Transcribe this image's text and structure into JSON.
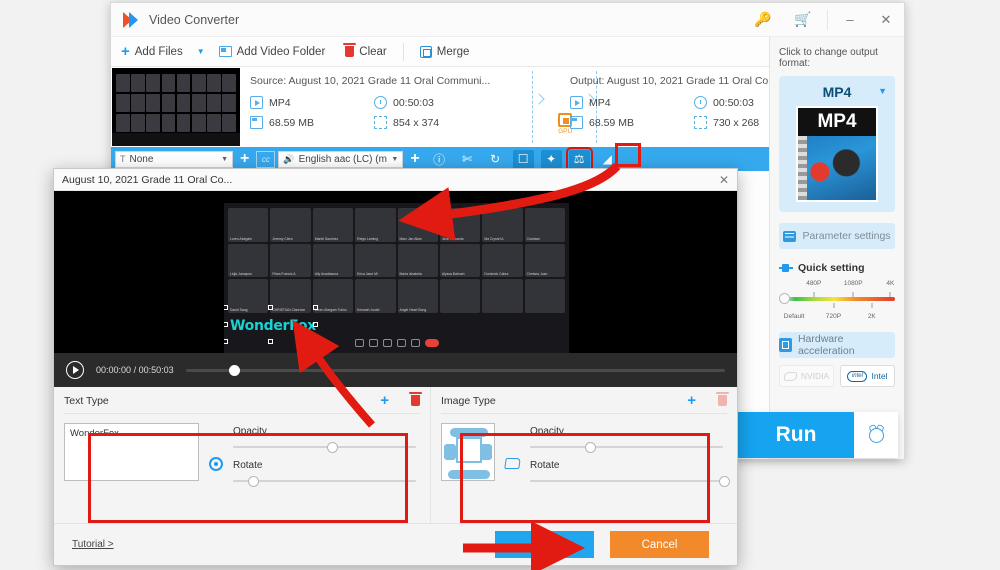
{
  "window": {
    "title": "Video Converter",
    "icons": {
      "key": "key-icon",
      "cart": "cart-icon",
      "minimize": "–",
      "close": "✕"
    }
  },
  "toolbar": {
    "add_files": "Add Files",
    "add_video_folder": "Add Video Folder",
    "clear": "Clear",
    "merge": "Merge"
  },
  "file_row": {
    "source_label": "Source: August 10, 2021 Grade 11 Oral Communi...",
    "output_label": "Output: August 10, 2021 Grade 11 Oral Com...",
    "source": {
      "format": "MP4",
      "duration": "00:50:03",
      "size": "68.59 MB",
      "resolution": "854 x 374"
    },
    "output": {
      "format": "MP4",
      "duration": "00:50:03",
      "size": "68.59 MB",
      "resolution": "730 x 268"
    },
    "gpu_badge": "GPU"
  },
  "blue_bar": {
    "subtitle_select": "None",
    "audio_select": "English aac (LC) (m",
    "tools": [
      "info-icon",
      "cut-icon",
      "rotate-icon",
      "crop-icon",
      "effects-icon",
      "watermark-icon",
      "adjust-icon"
    ]
  },
  "sidebar": {
    "hint": "Click to change output format:",
    "format": "MP4",
    "format_badge": "MP4",
    "parameter_settings": "Parameter settings",
    "quick_setting": "Quick setting",
    "slider_top_ticks": [
      "480P",
      "1080P",
      "4K"
    ],
    "slider_bottom_ticks": [
      "Default",
      "720P",
      "2K"
    ],
    "hardware_acceleration": "Hardware acceleration",
    "gpu_nvidia": "NVIDIA",
    "gpu_intel": "Intel"
  },
  "run": {
    "label": "Run",
    "alarm": "alarm-icon"
  },
  "dialog": {
    "title": "August 10, 2021 Grade 11 Oral Co...",
    "close": "✕",
    "player": {
      "current_time": "00:00:00",
      "separator": "/",
      "total_time": "00:50:03"
    },
    "watermark_text": "WonderFox",
    "text_type": {
      "heading": "Text Type",
      "value": "WonderFox",
      "opacity_label": "Opacity",
      "rotate_label": "Rotate",
      "opacity_value": 50,
      "rotate_value": 8
    },
    "image_type": {
      "heading": "Image Type",
      "opacity_label": "Opacity",
      "rotate_label": "Rotate",
      "opacity_value": 28,
      "rotate_value": 96
    },
    "tutorial": "Tutorial >",
    "ok": "Ok",
    "cancel": "Cancel"
  },
  "video_tiles": [
    "Loren Abegain",
    "Jeremy Clera",
    "Mariel Sanchez",
    "Reign Laming",
    "Marc Jan Allan",
    "Jiroh Rimando",
    "Ma Crystel A",
    "Charisse",
    "Lidja Jumapon",
    "Rhea Francis A",
    "Ally Anadiasora",
    "Erica Jane Mi",
    "Maria Ishabela",
    "Alyssa Bahrain",
    "Dominick Cabra",
    "Chelsea Joan",
    "David Saug",
    "CHRISTIAN Clarence",
    "Loren Abegain Tulino",
    "Kesmah Justel",
    "Angel Heart Bong",
    "",
    "",
    ""
  ],
  "colors": {
    "accent_blue": "#36a9ee",
    "run_blue": "#16a3ef",
    "cancel_orange": "#f2892a",
    "highlight_red": "#e21b12",
    "watermark_cyan": "#19d3d3",
    "gpu_orange": "#f0911e"
  }
}
